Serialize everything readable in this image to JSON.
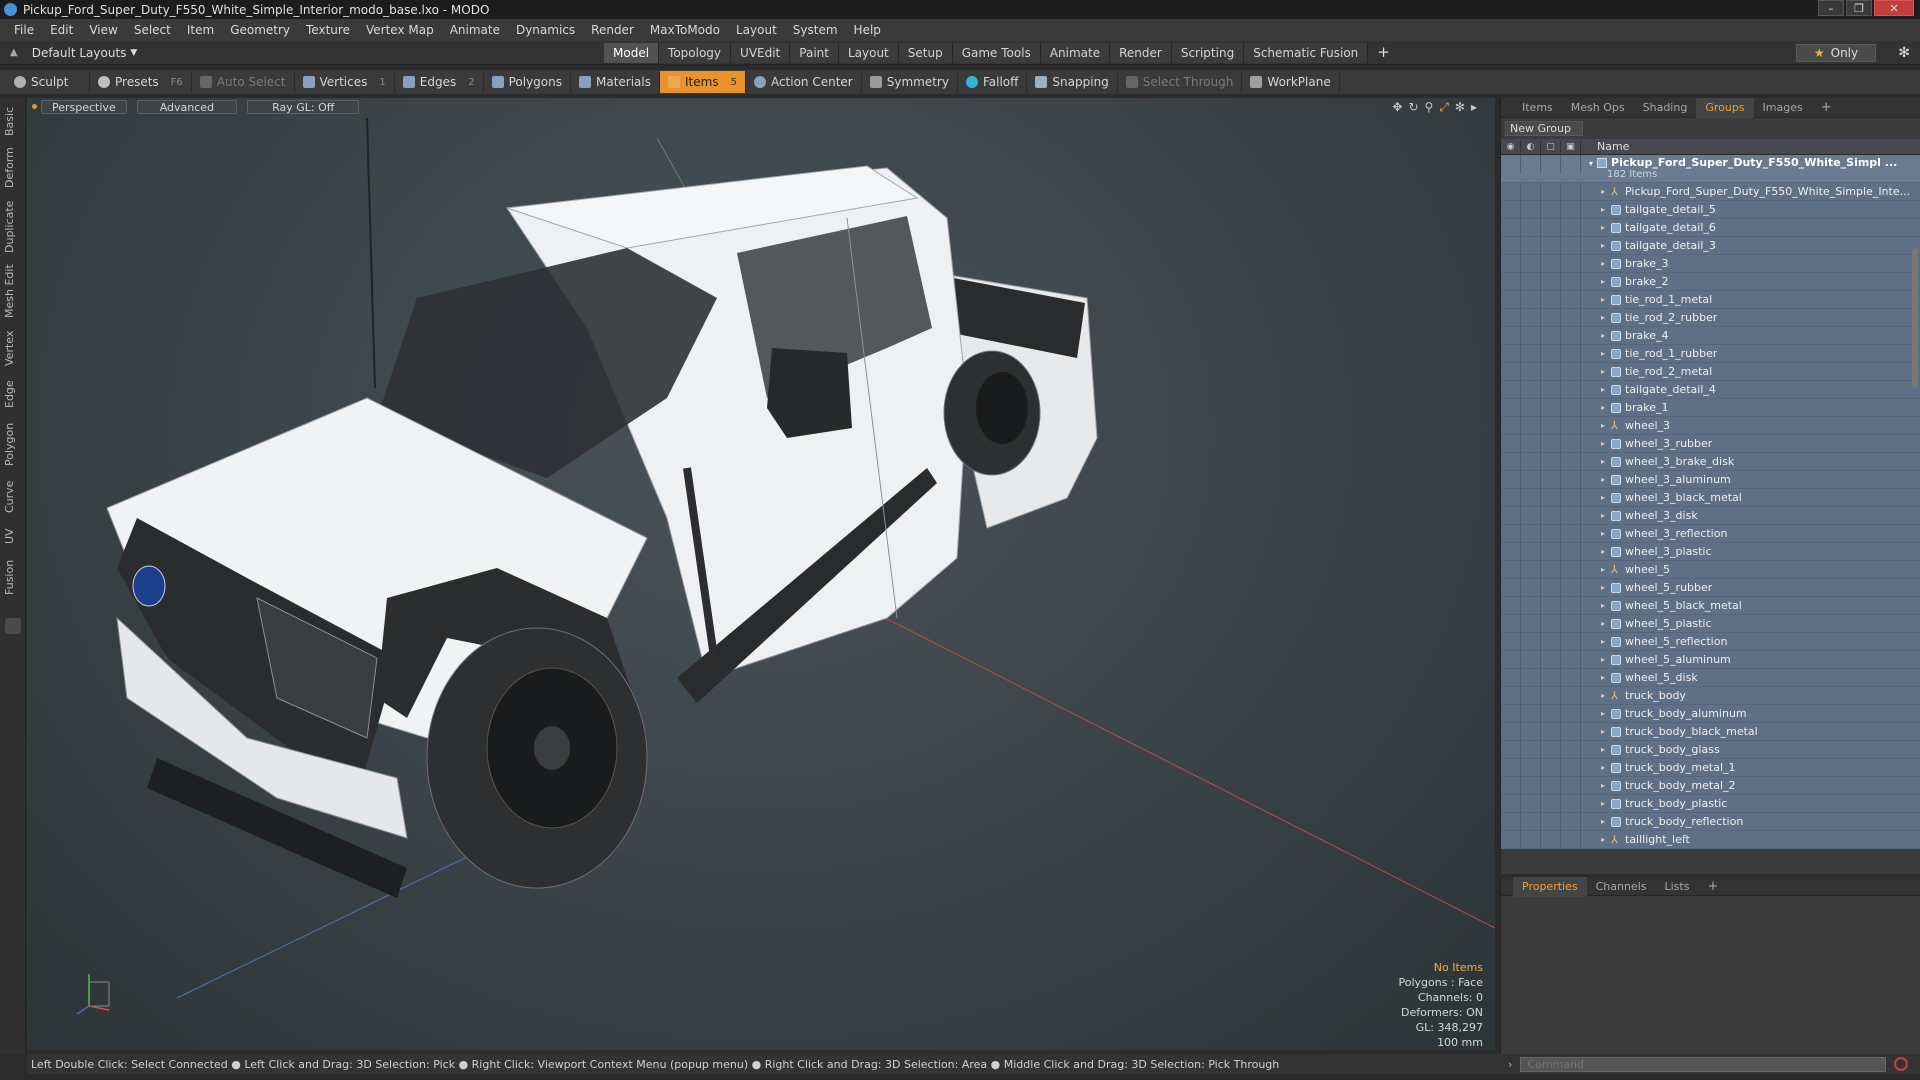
{
  "window": {
    "title": "Pickup_Ford_Super_Duty_F550_White_Simple_Interior_modo_base.lxo - MODO"
  },
  "menu": [
    "File",
    "Edit",
    "View",
    "Select",
    "Item",
    "Geometry",
    "Texture",
    "Vertex Map",
    "Animate",
    "Dynamics",
    "Render",
    "MaxToModo",
    "Layout",
    "System",
    "Help"
  ],
  "layoutbar": {
    "layout_name": "Default Layouts",
    "tabs": [
      {
        "label": "Model",
        "active": true
      },
      {
        "label": "Topology"
      },
      {
        "label": "UVEdit"
      },
      {
        "label": "Paint"
      },
      {
        "label": "Layout"
      },
      {
        "label": "Setup"
      },
      {
        "label": "Game Tools"
      },
      {
        "label": "Animate"
      },
      {
        "label": "Render"
      },
      {
        "label": "Scripting"
      },
      {
        "label": "Schematic Fusion"
      }
    ],
    "add": "+",
    "only_label": "Only"
  },
  "toolbar": {
    "sculpt": "Sculpt",
    "presets": "Presets",
    "presets_key": "F6",
    "auto_select": "Auto Select",
    "vertices": "Vertices",
    "vertices_key": "1",
    "edges": "Edges",
    "edges_key": "2",
    "polygons": "Polygons",
    "materials": "Materials",
    "items": "Items",
    "items_key": "5",
    "action_center": "Action Center",
    "symmetry": "Symmetry",
    "falloff": "Falloff",
    "snapping": "Snapping",
    "select_through": "Select Through",
    "workplane": "WorkPlane"
  },
  "left_tabs": [
    "Basic",
    "Deform",
    "Duplicate",
    "Mesh Edit",
    "Vertex",
    "Edge",
    "Polygon",
    "Curve",
    "UV",
    "Fusion"
  ],
  "viewport": {
    "view": "Perspective",
    "shading": "Advanced",
    "raygl": "Ray GL: Off",
    "info": {
      "selection": "No Items",
      "polygons": "Polygons : Face",
      "channels": "Channels: 0",
      "deformers": "Deformers: ON",
      "gl": "GL: 348,297",
      "scale": "100 mm"
    }
  },
  "right_panel": {
    "tabs": [
      {
        "label": "Items"
      },
      {
        "label": "Mesh Ops"
      },
      {
        "label": "Shading"
      },
      {
        "label": "Groups",
        "active": true
      },
      {
        "label": "Images"
      }
    ],
    "new_group": "New Group",
    "name_header": "Name",
    "root": {
      "title": "Pickup_Ford_Super_Duty_F550_White_Simpl ...",
      "count": "182 Items"
    },
    "items": [
      {
        "name": "Pickup_Ford_Super_Duty_F550_White_Simple_Inte...",
        "type": "locator"
      },
      {
        "name": "tailgate_detail_5",
        "type": "mesh"
      },
      {
        "name": "tailgate_detail_6",
        "type": "mesh"
      },
      {
        "name": "tailgate_detail_3",
        "type": "mesh"
      },
      {
        "name": "brake_3",
        "type": "mesh"
      },
      {
        "name": "brake_2",
        "type": "mesh"
      },
      {
        "name": "tie_rod_1_metal",
        "type": "mesh"
      },
      {
        "name": "tie_rod_2_rubber",
        "type": "mesh"
      },
      {
        "name": "brake_4",
        "type": "mesh"
      },
      {
        "name": "tie_rod_1_rubber",
        "type": "mesh"
      },
      {
        "name": "tie_rod_2_metal",
        "type": "mesh"
      },
      {
        "name": "tailgate_detail_4",
        "type": "mesh"
      },
      {
        "name": "brake_1",
        "type": "mesh"
      },
      {
        "name": "wheel_3",
        "type": "locator"
      },
      {
        "name": "wheel_3_rubber",
        "type": "mesh"
      },
      {
        "name": "wheel_3_brake_disk",
        "type": "mesh"
      },
      {
        "name": "wheel_3_aluminum",
        "type": "mesh"
      },
      {
        "name": "wheel_3_black_metal",
        "type": "mesh"
      },
      {
        "name": "wheel_3_disk",
        "type": "mesh"
      },
      {
        "name": "wheel_3_reflection",
        "type": "mesh"
      },
      {
        "name": "wheel_3_plastic",
        "type": "mesh"
      },
      {
        "name": "wheel_5",
        "type": "locator"
      },
      {
        "name": "wheel_5_rubber",
        "type": "mesh"
      },
      {
        "name": "wheel_5_black_metal",
        "type": "mesh"
      },
      {
        "name": "wheel_5_plastic",
        "type": "mesh"
      },
      {
        "name": "wheel_5_reflection",
        "type": "mesh"
      },
      {
        "name": "wheel_5_aluminum",
        "type": "mesh"
      },
      {
        "name": "wheel_5_disk",
        "type": "mesh"
      },
      {
        "name": "truck_body",
        "type": "locator"
      },
      {
        "name": "truck_body_aluminum",
        "type": "mesh"
      },
      {
        "name": "truck_body_black_metal",
        "type": "mesh"
      },
      {
        "name": "truck_body_glass",
        "type": "mesh"
      },
      {
        "name": "truck_body_metal_1",
        "type": "mesh"
      },
      {
        "name": "truck_body_metal_2",
        "type": "mesh"
      },
      {
        "name": "truck_body_plastic",
        "type": "mesh"
      },
      {
        "name": "truck_body_reflection",
        "type": "mesh"
      },
      {
        "name": "taillight_left",
        "type": "locator"
      }
    ]
  },
  "properties_panel": {
    "tabs": [
      {
        "label": "Properties",
        "active": true
      },
      {
        "label": "Channels"
      },
      {
        "label": "Lists"
      }
    ]
  },
  "statusbar": {
    "text": "Left Double Click: Select Connected ● Left Click and Drag: 3D Selection: Pick ● Right Click: Viewport Context Menu (popup menu) ● Right Click and Drag: 3D Selection: Area ● Middle Click and Drag: 3D Selection: Pick Through"
  },
  "command": {
    "placeholder": "Command"
  },
  "colors": {
    "accent": "#e8942a",
    "tree_row": "#5f6f85",
    "viewport_bg": "#3c4549"
  }
}
